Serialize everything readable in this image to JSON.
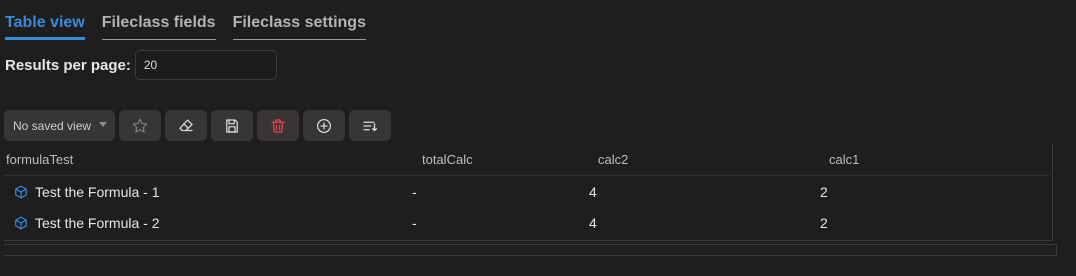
{
  "tabs": [
    {
      "label": "Table view"
    },
    {
      "label": "Fileclass fields"
    },
    {
      "label": "Fileclass settings"
    }
  ],
  "results_per_page": {
    "label": "Results per page:",
    "value": "20"
  },
  "toolbar": {
    "saved_view_label": "No saved view",
    "icons": [
      "star-icon",
      "eraser-icon",
      "save-icon",
      "trash-icon",
      "plus-circle-icon",
      "sort-lines-icon"
    ],
    "danger_color": "#e0474c"
  },
  "table": {
    "columns": [
      "formulaTest",
      "totalCalc",
      "calc2",
      "calc1"
    ],
    "rows": [
      {
        "formulaTest": "Test the Formula - 1",
        "totalCalc": "-",
        "calc2": "4",
        "calc1": "2"
      },
      {
        "formulaTest": "Test the Formula - 2",
        "totalCalc": "-",
        "calc2": "4",
        "calc1": "2"
      }
    ]
  },
  "colors": {
    "accent": "#3b8ad8",
    "background": "#1e1e1e"
  }
}
